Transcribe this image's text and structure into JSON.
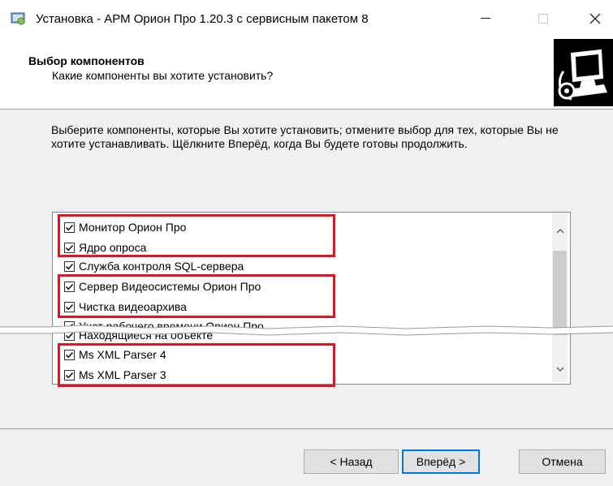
{
  "window": {
    "title": "Установка - АРМ Орион Про 1.20.3 с сервисным пакетом 8",
    "minimize_icon": "minimize-icon",
    "maximize_icon": "maximize-icon",
    "close_icon": "close-icon"
  },
  "header": {
    "title": "Выбор компонентов",
    "subtitle": "Какие компоненты вы хотите установить?",
    "logo_icon": "computer-install-icon"
  },
  "description": "Выберите компоненты, которые Вы хотите установить; отмените выбор для тех, которые Вы не хотите устанавливать. Щёлкните Вперёд, когда Вы будете готовы продолжить.",
  "components": [
    {
      "label": "Монитор Орион Про",
      "checked": true
    },
    {
      "label": "Ядро опроса",
      "checked": true
    },
    {
      "label": "Служба контроля SQL-сервера",
      "checked": true
    },
    {
      "label": "Сервер Видеосистемы Орион Про",
      "checked": true
    },
    {
      "label": "Чистка видеоархива",
      "checked": true
    },
    {
      "label": "Учет рабочего времени Орион Про",
      "checked": true
    },
    {
      "label": "Находящиеся на объекте",
      "checked": true
    },
    {
      "label": "Ms XML Parser 4",
      "checked": true
    },
    {
      "label": "Ms XML Parser 3",
      "checked": true
    }
  ],
  "scrollbar": {
    "up_icon": "chevron-up-icon",
    "down_icon": "chevron-down-icon"
  },
  "buttons": {
    "back": "< Назад",
    "next": "Вперёд >",
    "cancel": "Отмена"
  },
  "colors": {
    "highlight": "#e0161e",
    "default_button_border": "#0078d7"
  }
}
